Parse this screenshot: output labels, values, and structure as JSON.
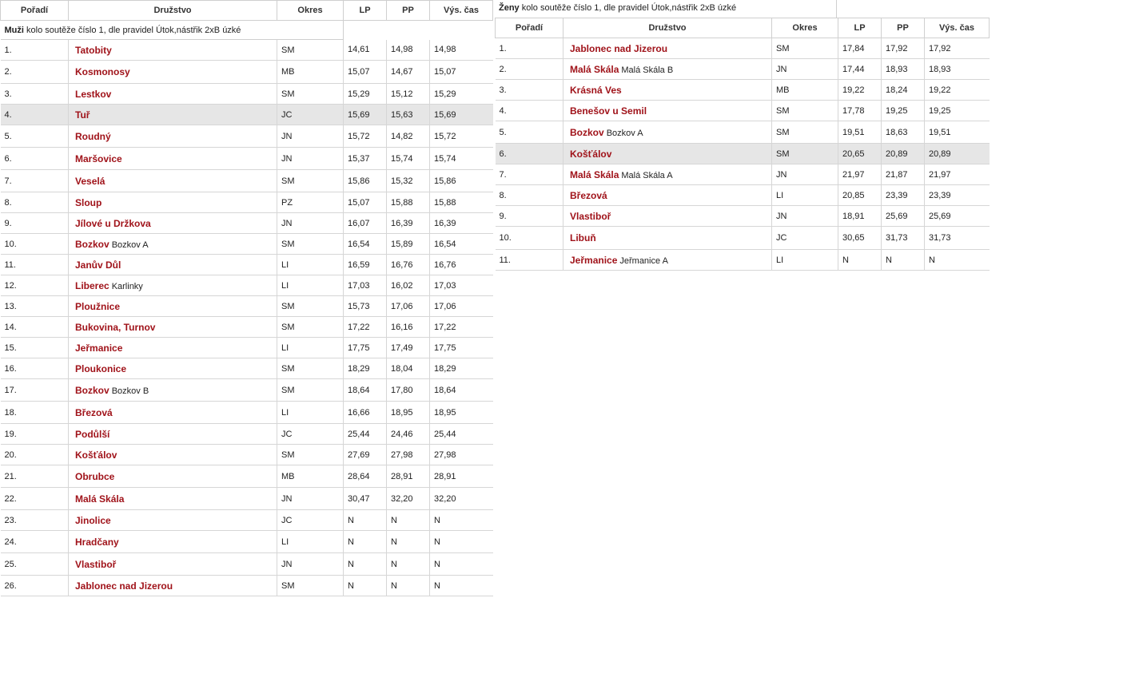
{
  "columns": {
    "rank": "Pořadí",
    "team": "Družstvo",
    "district": "Okres",
    "lp": "LP",
    "pp": "PP",
    "time": "Výs. čas"
  },
  "men": {
    "caption_bold": "Muži",
    "caption_rest": "kolo soutěže číslo 1, dle pravidel Útok,nástřik 2xB úzké",
    "rows": [
      {
        "rank": "1.",
        "team": "Tatobity",
        "sub": "",
        "district": "SM",
        "lp": "14,61",
        "pp": "14,98",
        "time": "14,98",
        "hl": false
      },
      {
        "rank": "2.",
        "team": "Kosmonosy",
        "sub": "",
        "district": "MB",
        "lp": "15,07",
        "pp": "14,67",
        "time": "15,07",
        "hl": false
      },
      {
        "rank": "3.",
        "team": "Lestkov",
        "sub": "",
        "district": "SM",
        "lp": "15,29",
        "pp": "15,12",
        "time": "15,29",
        "hl": false
      },
      {
        "rank": "4.",
        "team": "Tuř",
        "sub": "",
        "district": "JC",
        "lp": "15,69",
        "pp": "15,63",
        "time": "15,69",
        "hl": true
      },
      {
        "rank": "5.",
        "team": "Roudný",
        "sub": "",
        "district": "JN",
        "lp": "15,72",
        "pp": "14,82",
        "time": "15,72",
        "hl": false
      },
      {
        "rank": "6.",
        "team": "Maršovice",
        "sub": "",
        "district": "JN",
        "lp": "15,37",
        "pp": "15,74",
        "time": "15,74",
        "hl": false
      },
      {
        "rank": "7.",
        "team": "Veselá",
        "sub": "",
        "district": "SM",
        "lp": "15,86",
        "pp": "15,32",
        "time": "15,86",
        "hl": false
      },
      {
        "rank": "8.",
        "team": "Sloup",
        "sub": "",
        "district": "PZ",
        "lp": "15,07",
        "pp": "15,88",
        "time": "15,88",
        "hl": false
      },
      {
        "rank": "9.",
        "team": "Jílové u Držkova",
        "sub": "",
        "district": "JN",
        "lp": "16,07",
        "pp": "16,39",
        "time": "16,39",
        "hl": false
      },
      {
        "rank": "10.",
        "team": "Bozkov",
        "sub": "Bozkov A",
        "district": "SM",
        "lp": "16,54",
        "pp": "15,89",
        "time": "16,54",
        "hl": false
      },
      {
        "rank": "11.",
        "team": "Janův Důl",
        "sub": "",
        "district": "LI",
        "lp": "16,59",
        "pp": "16,76",
        "time": "16,76",
        "hl": false
      },
      {
        "rank": "12.",
        "team": "Liberec",
        "sub": "Karlinky",
        "district": "LI",
        "lp": "17,03",
        "pp": "16,02",
        "time": "17,03",
        "hl": false
      },
      {
        "rank": "13.",
        "team": "Ploužnice",
        "sub": "",
        "district": "SM",
        "lp": "15,73",
        "pp": "17,06",
        "time": "17,06",
        "hl": false
      },
      {
        "rank": "14.",
        "team": "Bukovina, Turnov",
        "sub": "",
        "district": "SM",
        "lp": "17,22",
        "pp": "16,16",
        "time": "17,22",
        "hl": false
      },
      {
        "rank": "15.",
        "team": "Jeřmanice",
        "sub": "",
        "district": "LI",
        "lp": "17,75",
        "pp": "17,49",
        "time": "17,75",
        "hl": false
      },
      {
        "rank": "16.",
        "team": "Ploukonice",
        "sub": "",
        "district": "SM",
        "lp": "18,29",
        "pp": "18,04",
        "time": "18,29",
        "hl": false
      },
      {
        "rank": "17.",
        "team": "Bozkov",
        "sub": "Bozkov B",
        "district": "SM",
        "lp": "18,64",
        "pp": "17,80",
        "time": "18,64",
        "hl": false
      },
      {
        "rank": "18.",
        "team": "Březová",
        "sub": "",
        "district": "LI",
        "lp": "16,66",
        "pp": "18,95",
        "time": "18,95",
        "hl": false
      },
      {
        "rank": "19.",
        "team": "Podůlší",
        "sub": "",
        "district": "JC",
        "lp": "25,44",
        "pp": "24,46",
        "time": "25,44",
        "hl": false
      },
      {
        "rank": "20.",
        "team": "Košťálov",
        "sub": "",
        "district": "SM",
        "lp": "27,69",
        "pp": "27,98",
        "time": "27,98",
        "hl": false
      },
      {
        "rank": "21.",
        "team": "Obrubce",
        "sub": "",
        "district": "MB",
        "lp": "28,64",
        "pp": "28,91",
        "time": "28,91",
        "hl": false
      },
      {
        "rank": "22.",
        "team": "Malá Skála",
        "sub": "",
        "district": "JN",
        "lp": "30,47",
        "pp": "32,20",
        "time": "32,20",
        "hl": false
      },
      {
        "rank": "23.",
        "team": "Jinolice",
        "sub": "",
        "district": "JC",
        "lp": "N",
        "pp": "N",
        "time": "N",
        "hl": false
      },
      {
        "rank": "24.",
        "team": "Hradčany",
        "sub": "",
        "district": "LI",
        "lp": "N",
        "pp": "N",
        "time": "N",
        "hl": false
      },
      {
        "rank": "25.",
        "team": "Vlastiboř",
        "sub": "",
        "district": "JN",
        "lp": "N",
        "pp": "N",
        "time": "N",
        "hl": false
      },
      {
        "rank": "26.",
        "team": "Jablonec nad Jizerou",
        "sub": "",
        "district": "SM",
        "lp": "N",
        "pp": "N",
        "time": "N",
        "hl": false
      }
    ]
  },
  "women": {
    "caption_bold": "Ženy",
    "caption_rest": "kolo soutěže číslo 1, dle pravidel Útok,nástřik 2xB úzké",
    "rows": [
      {
        "rank": "1.",
        "team": "Jablonec nad Jizerou",
        "sub": "",
        "district": "SM",
        "lp": "17,84",
        "pp": "17,92",
        "time": "17,92",
        "hl": false
      },
      {
        "rank": "2.",
        "team": "Malá Skála",
        "sub": "Malá Skála B",
        "district": "JN",
        "lp": "17,44",
        "pp": "18,93",
        "time": "18,93",
        "hl": false
      },
      {
        "rank": "3.",
        "team": "Krásná Ves",
        "sub": "",
        "district": "MB",
        "lp": "19,22",
        "pp": "18,24",
        "time": "19,22",
        "hl": false
      },
      {
        "rank": "4.",
        "team": "Benešov u Semil",
        "sub": "",
        "district": "SM",
        "lp": "17,78",
        "pp": "19,25",
        "time": "19,25",
        "hl": false
      },
      {
        "rank": "5.",
        "team": "Bozkov",
        "sub": "Bozkov A",
        "district": "SM",
        "lp": "19,51",
        "pp": "18,63",
        "time": "19,51",
        "hl": false
      },
      {
        "rank": "6.",
        "team": "Košťálov",
        "sub": "",
        "district": "SM",
        "lp": "20,65",
        "pp": "20,89",
        "time": "20,89",
        "hl": true
      },
      {
        "rank": "7.",
        "team": "Malá Skála",
        "sub": "Malá Skála A",
        "district": "JN",
        "lp": "21,97",
        "pp": "21,87",
        "time": "21,97",
        "hl": false
      },
      {
        "rank": "8.",
        "team": "Březová",
        "sub": "",
        "district": "LI",
        "lp": "20,85",
        "pp": "23,39",
        "time": "23,39",
        "hl": false
      },
      {
        "rank": "9.",
        "team": "Vlastiboř",
        "sub": "",
        "district": "JN",
        "lp": "18,91",
        "pp": "25,69",
        "time": "25,69",
        "hl": false
      },
      {
        "rank": "10.",
        "team": "Libuň",
        "sub": "",
        "district": "JC",
        "lp": "30,65",
        "pp": "31,73",
        "time": "31,73",
        "hl": false
      },
      {
        "rank": "11.",
        "team": "Jeřmanice",
        "sub": "Jeřmanice A",
        "district": "LI",
        "lp": "N",
        "pp": "N",
        "time": "N",
        "hl": false
      }
    ]
  }
}
